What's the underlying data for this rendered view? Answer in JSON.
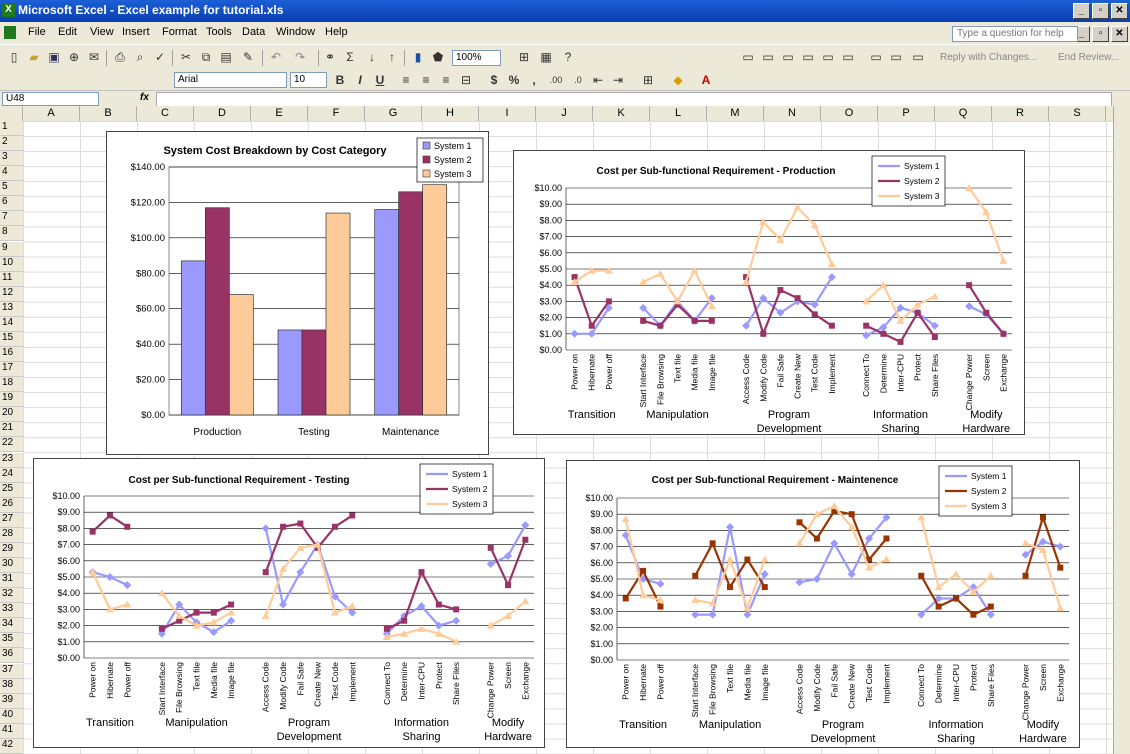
{
  "window": {
    "title": "Microsoft Excel - Excel example for tutorial.xls"
  },
  "menu": [
    "File",
    "Edit",
    "View",
    "Insert",
    "Format",
    "Tools",
    "Data",
    "Window",
    "Help"
  ],
  "help_placeholder": "Type a question for help",
  "toolbar": {
    "zoom": "100%",
    "reply": "Reply with Changes...",
    "end_review": "End Review...",
    "font": "Arial",
    "size": "10",
    "bold": "B",
    "italic": "I",
    "underline": "U",
    "currency": "$",
    "percent": "%",
    "comma": ","
  },
  "name_box": "U48",
  "fx": "fx",
  "columns": [
    "A",
    "B",
    "C",
    "D",
    "E",
    "F",
    "G",
    "H",
    "I",
    "J",
    "K",
    "L",
    "M",
    "N",
    "O",
    "P",
    "Q",
    "R",
    "S"
  ],
  "rows": [
    "1",
    "2",
    "3",
    "4",
    "5",
    "6",
    "7",
    "8",
    "9",
    "10",
    "11",
    "12",
    "13",
    "14",
    "15",
    "16",
    "17",
    "18",
    "19",
    "20",
    "21",
    "22",
    "23",
    "24",
    "25",
    "26",
    "27",
    "28",
    "29",
    "30",
    "31",
    "32",
    "33",
    "34",
    "35",
    "36",
    "37",
    "38",
    "39",
    "40",
    "41",
    "42"
  ],
  "chart_data": [
    {
      "type": "bar",
      "title": "System Cost Breakdown by Cost Category",
      "categories": [
        "Production",
        "Testing",
        "Maintenance"
      ],
      "series": [
        {
          "name": "System 1",
          "values": [
            87,
            48,
            116
          ]
        },
        {
          "name": "System 2",
          "values": [
            117,
            48,
            126
          ]
        },
        {
          "name": "System 3",
          "values": [
            68,
            114,
            130
          ]
        }
      ],
      "ylim": [
        0,
        140
      ],
      "yticks": [
        "$0.00",
        "$20.00",
        "$40.00",
        "$60.00",
        "$80.00",
        "$100.00",
        "$120.00",
        "$140.00"
      ],
      "legend": "top-right",
      "colors": [
        "#9999ff",
        "#993366",
        "#ffcc99"
      ]
    },
    {
      "type": "line",
      "title": "Cost per Sub-functional Requirement - Production",
      "groups": [
        {
          "label": [
            "Transition"
          ],
          "items": [
            "Power on",
            "Hibernate",
            "Power off"
          ]
        },
        {
          "label": [
            "Manipulation"
          ],
          "items": [
            "Start Interface",
            "File Browsing",
            "Text file",
            "Media file",
            "Image file"
          ]
        },
        {
          "label": [
            "Program",
            "Development"
          ],
          "items": [
            "Access Code",
            "Modify Code",
            "Fail Safe",
            "Create New",
            "Test Code",
            "Implement"
          ]
        },
        {
          "label": [
            "Information",
            "Sharing"
          ],
          "items": [
            "Connect To",
            "Determine",
            "Inter-CPU",
            "Protect",
            "Share Files"
          ]
        },
        {
          "label": [
            "Modify",
            "Hardware"
          ],
          "items": [
            "Change Power",
            "Screen",
            "Exchange"
          ]
        }
      ],
      "series": [
        {
          "name": "System 1",
          "values": [
            [
              1.0,
              1.0,
              2.6
            ],
            [
              2.6,
              1.5,
              3.0,
              1.8,
              3.2
            ],
            [
              1.5,
              3.2,
              2.3,
              3.0,
              2.8,
              4.5
            ],
            [
              0.9,
              1.4,
              2.6,
              2.3,
              1.5
            ],
            [
              2.7,
              2.2,
              1.0
            ]
          ]
        },
        {
          "name": "System 2",
          "values": [
            [
              4.5,
              1.5,
              3.0
            ],
            [
              1.8,
              1.5,
              2.8,
              1.8,
              1.8
            ],
            [
              4.5,
              1.0,
              3.7,
              3.2,
              2.2,
              1.5
            ],
            [
              1.5,
              1.0,
              0.5,
              2.3,
              0.8
            ],
            [
              4.0,
              2.3,
              1.0
            ]
          ]
        },
        {
          "name": "System 3",
          "values": [
            [
              4.2,
              4.9,
              4.9
            ],
            [
              4.2,
              4.7,
              3.0,
              4.9,
              2.7
            ],
            [
              4.2,
              7.9,
              6.8,
              8.8,
              7.7,
              5.3
            ],
            [
              3.0,
              4.0,
              1.8,
              2.8,
              3.3
            ],
            [
              10.0,
              8.5,
              5.5
            ]
          ]
        }
      ],
      "ylim": [
        0,
        10
      ],
      "yticks": [
        "$0.00",
        "$1.00",
        "$2.00",
        "$3.00",
        "$4.00",
        "$5.00",
        "$6.00",
        "$7.00",
        "$8.00",
        "$9.00",
        "$10.00"
      ],
      "legend": "top-right",
      "colors": [
        "#9999ff",
        "#993366",
        "#ffcc99"
      ]
    },
    {
      "type": "line",
      "title": "Cost per Sub-functional Requirement - Testing",
      "groups": [
        {
          "label": [
            "Transition"
          ],
          "items": [
            "Power on",
            "Hibernate",
            "Power off"
          ]
        },
        {
          "label": [
            "Manipulation"
          ],
          "items": [
            "Start Interface",
            "File Browsing",
            "Text file",
            "Media file",
            "Image file"
          ]
        },
        {
          "label": [
            "Program",
            "Development"
          ],
          "items": [
            "Access Code",
            "Modify Code",
            "Fail Safe",
            "Create New",
            "Test Code",
            "Implement"
          ]
        },
        {
          "label": [
            "Information",
            "Sharing"
          ],
          "items": [
            "Connect To",
            "Determine",
            "Inter-CPU",
            "Protect",
            "Share Files"
          ]
        },
        {
          "label": [
            "Modify",
            "Hardware"
          ],
          "items": [
            "Change Power",
            "Screen",
            "Exchange"
          ]
        }
      ],
      "series": [
        {
          "name": "System 1",
          "values": [
            [
              5.3,
              5.0,
              4.5
            ],
            [
              1.5,
              3.3,
              2.2,
              1.6,
              2.3
            ],
            [
              8.0,
              3.3,
              5.3,
              7.0,
              3.8,
              2.8
            ],
            [
              1.5,
              2.6,
              3.2,
              2.0,
              2.3
            ],
            [
              5.8,
              6.3,
              8.2
            ]
          ]
        },
        {
          "name": "System 2",
          "values": [
            [
              7.8,
              8.8,
              8.1
            ],
            [
              1.8,
              2.3,
              2.8,
              2.8,
              3.3
            ],
            [
              5.3,
              8.1,
              8.3,
              6.8,
              8.1,
              8.8
            ],
            [
              1.8,
              2.3,
              5.3,
              3.3,
              3.0
            ],
            [
              6.8,
              4.5,
              7.3
            ]
          ]
        },
        {
          "name": "System 3",
          "values": [
            [
              5.3,
              3.0,
              3.3
            ],
            [
              4.0,
              2.6,
              2.0,
              2.2,
              2.8
            ],
            [
              2.6,
              5.5,
              6.8,
              7.0,
              2.8,
              3.2
            ],
            [
              1.3,
              1.5,
              1.8,
              1.5,
              1.0
            ],
            [
              2.0,
              2.6,
              3.5
            ]
          ]
        }
      ],
      "ylim": [
        0,
        10
      ],
      "yticks": [
        "$0.00",
        "$1.00",
        "$2.00",
        "$3.00",
        "$4.00",
        "$5.00",
        "$6.00",
        "$7.00",
        "$8.00",
        "$9.00",
        "$10.00"
      ],
      "legend": "top-right",
      "colors": [
        "#9999ff",
        "#993366",
        "#ffcc99"
      ]
    },
    {
      "type": "line",
      "title": "Cost per Sub-functional Requirement - Maintenence",
      "groups": [
        {
          "label": [
            "Transition"
          ],
          "items": [
            "Power on",
            "Hibernate",
            "Power off"
          ]
        },
        {
          "label": [
            "Manipulation"
          ],
          "items": [
            "Start Interface",
            "File Browsing",
            "Text file",
            "Media file",
            "Image file"
          ]
        },
        {
          "label": [
            "Program",
            "Development"
          ],
          "items": [
            "Access Code",
            "Modify Code",
            "Fail Safe",
            "Create New",
            "Test Code",
            "Implement"
          ]
        },
        {
          "label": [
            "Information",
            "Sharing"
          ],
          "items": [
            "Connect To",
            "Determine",
            "Inter-CPU",
            "Protect",
            "Share Files"
          ]
        },
        {
          "label": [
            "Modify",
            "Hardware"
          ],
          "items": [
            "Change Power",
            "Screen",
            "Exchange"
          ]
        }
      ],
      "series": [
        {
          "name": "System 1",
          "values": [
            [
              7.7,
              5.0,
              4.7
            ],
            [
              2.8,
              2.8,
              8.2,
              2.8,
              5.3
            ],
            [
              4.8,
              5.0,
              7.2,
              5.3,
              7.5,
              8.8
            ],
            [
              2.8,
              3.8,
              3.8,
              4.5,
              2.8
            ],
            [
              6.5,
              7.3,
              7.0
            ]
          ]
        },
        {
          "name": "System 2",
          "values": [
            [
              3.8,
              5.5,
              3.3
            ],
            [
              5.2,
              7.2,
              4.5,
              6.2,
              4.5
            ],
            [
              8.5,
              7.5,
              9.2,
              9.0,
              6.2,
              7.5
            ],
            [
              5.2,
              3.3,
              3.8,
              2.8,
              3.3
            ],
            [
              5.2,
              8.8,
              5.7
            ]
          ]
        },
        {
          "name": "System 3",
          "values": [
            [
              8.7,
              4.0,
              3.7
            ],
            [
              3.7,
              3.5,
              6.2,
              3.2,
              6.2
            ],
            [
              7.2,
              9.0,
              9.5,
              8.2,
              5.7,
              6.2
            ],
            [
              8.8,
              4.5,
              5.3,
              4.2,
              5.2
            ],
            [
              7.2,
              6.8,
              3.2
            ]
          ]
        }
      ],
      "ylim": [
        0,
        10
      ],
      "yticks": [
        "$0.00",
        "$1.00",
        "$2.00",
        "$3.00",
        "$4.00",
        "$5.00",
        "$6.00",
        "$7.00",
        "$8.00",
        "$9.00",
        "$10.00"
      ],
      "legend": "top-right",
      "colors": [
        "#9999ff",
        "#993300",
        "#ffcc99"
      ]
    }
  ]
}
